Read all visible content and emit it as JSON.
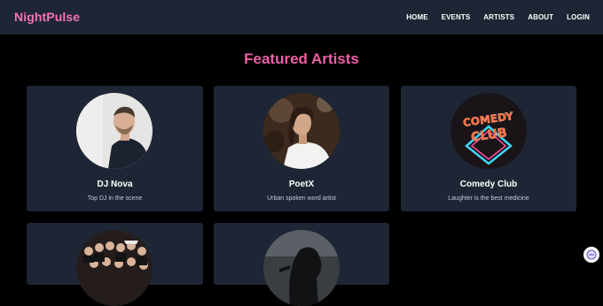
{
  "header": {
    "brand": "NightPulse",
    "nav": [
      "HOME",
      "EVENTS",
      "ARTISTS",
      "ABOUT",
      "LOGIN"
    ]
  },
  "main": {
    "title": "Featured Artists",
    "artists": [
      {
        "name": "DJ Nova",
        "description": "Top DJ in the scene"
      },
      {
        "name": "PoetX",
        "description": "Urban spoken word artist"
      },
      {
        "name": "Comedy Club",
        "description": "Laughter is the best medicine",
        "neon_sign": [
          "COMEDY",
          "CLUB"
        ]
      },
      {
        "name": "",
        "description": ""
      },
      {
        "name": "",
        "description": ""
      }
    ]
  },
  "colors": {
    "accent": "#ec5fa5",
    "nav_bg": "#1e2635",
    "card_bg": "#1e2635",
    "page_bg": "#000000"
  },
  "icons": {
    "chat_widget": "chat-bubble-icon"
  }
}
